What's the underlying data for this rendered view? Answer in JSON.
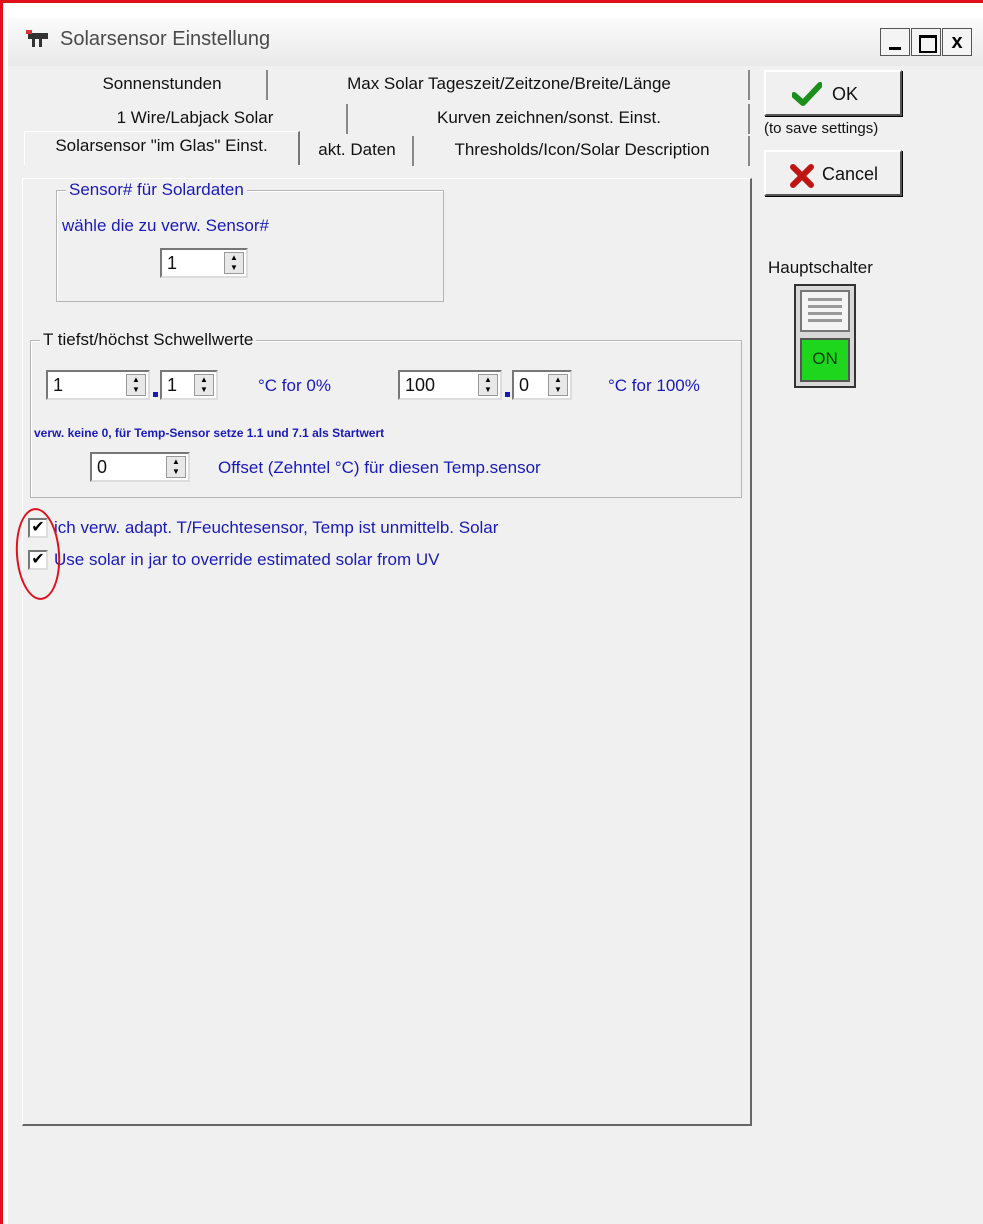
{
  "window": {
    "title": "Solarsensor Einstellung",
    "close_glyph": "x"
  },
  "tabs": {
    "row1": [
      "Sonnenstunden",
      "Max Solar Tageszeit/Zeitzone/Breite/Länge"
    ],
    "row2": [
      "1 Wire/Labjack Solar",
      "Kurven zeichnen/sonst. Einst."
    ],
    "row3": [
      "Solarsensor \"im Glas\" Einst.",
      "akt. Daten",
      "Thresholds/Icon/Solar Description"
    ],
    "active": "Solarsensor \"im Glas\" Einst."
  },
  "sensor_group": {
    "title": "Sensor# für Solardaten",
    "caption": "wähle die zu verw. Sensor#",
    "sensor_value": "1"
  },
  "threshold_group": {
    "title": "T tiefst/höchst Schwellwerte",
    "low_int": "1",
    "low_dec": "1",
    "low_label": "°C for 0%",
    "high_int": "100",
    "high_dec": "0",
    "high_label": "°C for 100%",
    "note": "verw. keine 0, für Temp-Sensor setze 1.1 und 7.1 als Startwert",
    "offset_value": "0",
    "offset_label": "Offset  (Zehntel °C) für diesen Temp.sensor"
  },
  "checkboxes": [
    {
      "label": "ich verw. adapt. T/Feuchtesensor, Temp ist unmittelb. Solar",
      "checked": true
    },
    {
      "label": "Use solar in jar to override estimated solar from UV",
      "checked": true
    }
  ],
  "buttons": {
    "ok_label": "OK",
    "ok_hint": "(to save settings)",
    "cancel_label": "Cancel"
  },
  "main_switch": {
    "label": "Hauptschalter",
    "state": "ON"
  },
  "colors": {
    "accent_text": "#1a1ab8",
    "switch_on": "#1fd61f",
    "annotation": "#e0101a"
  },
  "icons": [
    "app-icon",
    "checkmark-icon",
    "cancel-x-icon",
    "spinner-arrows-icon"
  ]
}
